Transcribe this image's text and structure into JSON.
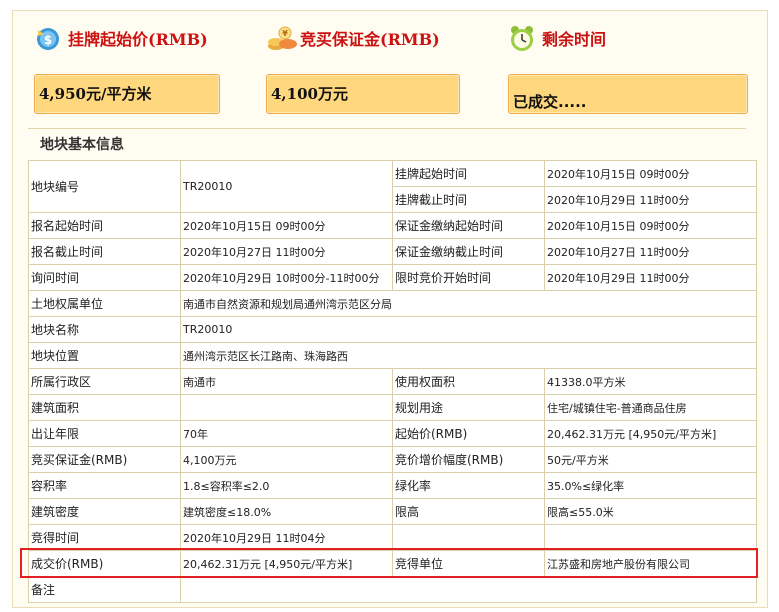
{
  "summary": {
    "start_price": {
      "title": "挂牌起始价(RMB)",
      "value": "4,950元/平方米",
      "icon": "money-icon"
    },
    "deposit": {
      "title": "竞买保证金(RMB)",
      "value": "4,100万元",
      "icon": "coins-icon"
    },
    "remaining": {
      "title": "剩余时间",
      "value": "已成交.....",
      "icon": "alarm-clock-icon"
    }
  },
  "section_title": "地块基本信息",
  "rows": {
    "r1": {
      "l1": "地块编号",
      "v1": "TR20010",
      "l2a": "挂牌起始时间",
      "v2a": "2020年10月15日 09时00分",
      "l2b": "挂牌截止时间",
      "v2b": "2020年10月29日 11时00分"
    },
    "r3": {
      "l1": "报名起始时间",
      "v1": "2020年10月15日 09时00分",
      "l2": "保证金缴纳起始时间",
      "v2": "2020年10月15日 09时00分"
    },
    "r4": {
      "l1": "报名截止时间",
      "v1": "2020年10月27日 11时00分",
      "l2": "保证金缴纳截止时间",
      "v2": "2020年10月27日 11时00分"
    },
    "r5": {
      "l1": "询问时间",
      "v1": "2020年10月29日 10时00分-11时00分",
      "l2": "限时竞价开始时间",
      "v2": "2020年10月29日 11时00分"
    },
    "r6": {
      "l1": "土地权属单位",
      "v1": "南通市自然资源和规划局通州湾示范区分局"
    },
    "r7": {
      "l1": "地块名称",
      "v1": "TR20010"
    },
    "r8": {
      "l1": "地块位置",
      "v1": "通州湾示范区长江路南、珠海路西"
    },
    "r9": {
      "l1": "所属行政区",
      "v1": "南通市",
      "l2": "使用权面积",
      "v2": "41338.0平方米"
    },
    "r10": {
      "l1": "建筑面积",
      "v1": "",
      "l2": "规划用途",
      "v2": "住宅/城镇住宅-普通商品住房"
    },
    "r11": {
      "l1": "出让年限",
      "v1": "70年",
      "l2": "起始价(RMB)",
      "v2": "20,462.31万元 [4,950元/平方米]"
    },
    "r12": {
      "l1": "竞买保证金(RMB)",
      "v1": "4,100万元",
      "l2": "竞价增价幅度(RMB)",
      "v2": "50元/平方米"
    },
    "r13": {
      "l1": "容积率",
      "v1": "1.8≤容积率≤2.0",
      "l2": "绿化率",
      "v2": "35.0%≤绿化率"
    },
    "r14": {
      "l1": "建筑密度",
      "v1": "建筑密度≤18.0%",
      "l2": "限高",
      "v2": "限高≤55.0米"
    },
    "r15": {
      "l1": "竞得时间",
      "v1": "2020年10月29日 11时04分",
      "l2": "",
      "v2": ""
    },
    "r16": {
      "l1": "成交价(RMB)",
      "v1": "20,462.31万元 [4,950元/平方米]",
      "l2": "竞得单位",
      "v2": "江苏盛和房地产股份有限公司"
    },
    "r17": {
      "l1": "备注",
      "v1": ""
    }
  },
  "colors": {
    "title_red": "#cc1111",
    "box_fill": "#ffd77f",
    "highlight": "#e22222"
  }
}
